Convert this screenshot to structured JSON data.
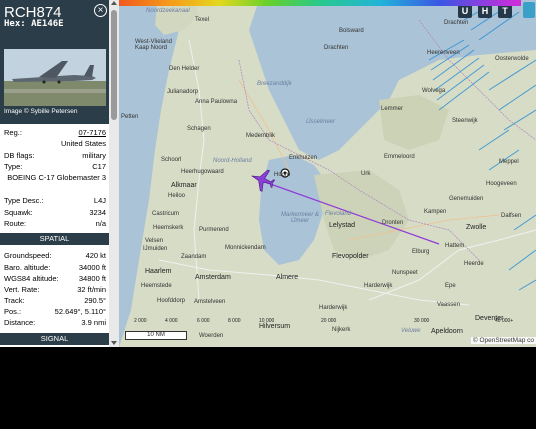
{
  "aircraft": {
    "callsign": "RCH874",
    "hex_label": "Hex: AE146E",
    "photo_credit": "Image © Sybille Petersen",
    "reg_label": "Reg.:",
    "reg_value": "07-7176",
    "country": "United States",
    "dbflags_label": "DB flags:",
    "dbflags_value": "military",
    "type_label": "Type:",
    "type_value": "C17",
    "type_name": "BOEING C-17 Globemaster 3",
    "typedesc_label": "Type Desc.:",
    "typedesc_value": "L4J",
    "squawk_label": "Squawk:",
    "squawk_value": "3234",
    "route_label": "Route:",
    "route_value": "n/a"
  },
  "spatial": {
    "header": "SPATIAL",
    "groundspeed_label": "Groundspeed:",
    "groundspeed_value": "420 kt",
    "baro_label": "Baro. altitude:",
    "baro_value": "34000 ft",
    "wgs_label": "WGS84 altitude:",
    "wgs_value": "34800 ft",
    "vrate_label": "Vert. Rate:",
    "vrate_value": "32 ft/min",
    "track_label": "Track:",
    "track_value": "290.5°",
    "pos_label": "Pos.:",
    "pos_value": "52.649°, 5.110°",
    "dist_label": "Distance:",
    "dist_value": "3.9 nmi"
  },
  "signal": {
    "header": "SIGNAL"
  },
  "map": {
    "buttons": [
      "U",
      "H",
      "T"
    ],
    "labels": {
      "noordzeekanaal": "Noordzeekanaal",
      "texel": "Texel",
      "den_helder": "Den Helder",
      "julianadorp": "Julianadorp",
      "anna_paulowna": "Anna Paulowna",
      "breezand": "Breezanddijk",
      "schagen": "Schagen",
      "medemblik": "Medemblik",
      "ijsselmeer": "IJsselmeer",
      "petten": "Petten",
      "schoorl": "Schoorl",
      "heerhugowaard": "Heerhugowaard",
      "noord_holland": "Noord-Holland",
      "enkhuizen": "Enkhuizen",
      "hoorn": "Hoorn",
      "alkmaar": "Alkmaar",
      "heiloo": "Heiloo",
      "castricum": "Castricum",
      "markermeer": "Markermeer & IJmeer",
      "purmerend": "Purmerend",
      "ijmuiden": "IJmuiden",
      "zaandam": "Zaandam",
      "monnickendam": "Monnickendam",
      "haarlem": "Haarlem",
      "amsterdam": "Amsterdam",
      "almere": "Almere",
      "heemstede": "Heemstede",
      "hoofddorp": "Hoofddorp",
      "amstelveen": "Amstelveen",
      "hilversum": "Hilversum",
      "nijkerk": "Nijkerk",
      "lelystad": "Lelystad",
      "flevoland": "Flevoland",
      "dronten": "Dronten",
      "flevopolder": "Flevopolder",
      "urk": "Urk",
      "emmeloord": "Emmeloord",
      "lemmer": "Lemmer",
      "bolsward": "Bolsward",
      "heerenveen": "Heerenveen",
      "meppel": "Meppel",
      "kampen": "Kampen",
      "zwolle": "Zwolle",
      "elburg": "Elburg",
      "harderwijk": "Harderwijk",
      "nunspeet": "Nunspeet",
      "heerde": "Heerde",
      "epe": "Epe",
      "vaassen": "Vaassen",
      "apeldoorn": "Apeldoorn",
      "deventer": "Deventer",
      "veluwe": "Veluwe",
      "drachten": "Drachten",
      "oosterwolde": "Oosterwolde",
      "wolvega": "Wolvega",
      "steenwijk": "Steenwijk",
      "hattem": "Hattem",
      "heemskerk": "Heemskerk",
      "velsen": "Velsen",
      "harderwijk2": "Harderwijk",
      "drachten2": "Drachten",
      "dalfsen": "Dalfsen",
      "hoogeveen": "Hoogeveen",
      "genemuiden": "Genemuiden",
      "woerden": "Woerden",
      "west_vlieland": "West-Vlieland",
      "kaap": "Kaap Noord"
    },
    "altitude_ticks": [
      "2 000",
      "4 000",
      "6 000",
      "8 000",
      "10 000",
      "20 000",
      "30 000",
      "40 000+"
    ],
    "scale_label": "10 NM",
    "attribution": "© OpenStreetMap co"
  }
}
